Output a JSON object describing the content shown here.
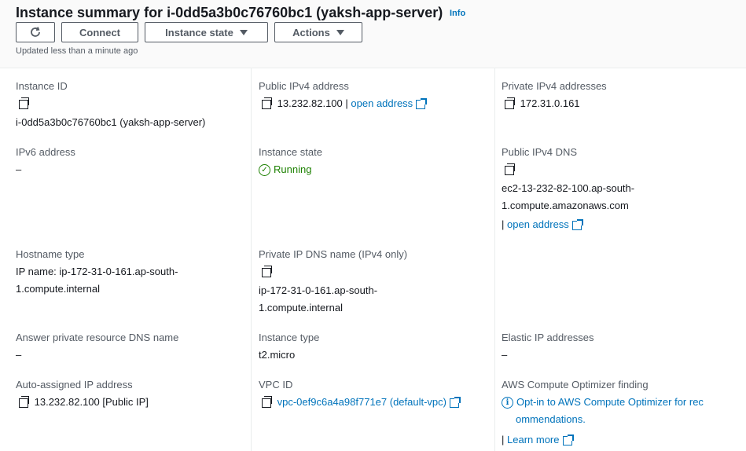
{
  "header": {
    "title": "Instance summary for i-0dd5a3b0c76760bc1 (yaksh-app-server)",
    "info_label": "Info",
    "connect_label": "Connect",
    "instance_state_label": "Instance state",
    "actions_label": "Actions",
    "updated_text": "Updated less than a minute ago",
    "refresh_icon": "refresh-icon"
  },
  "fields": {
    "instance_id": {
      "label": "Instance ID",
      "value": "i-0dd5a3b0c76760bc1 (yaksh-app-server)"
    },
    "public_ipv4": {
      "label": "Public IPv4 address",
      "value": "13.232.82.100",
      "separator": "|",
      "link": "open address"
    },
    "private_ipv4": {
      "label": "Private IPv4 addresses",
      "value": "172.31.0.161"
    },
    "ipv6": {
      "label": "IPv6 address",
      "value": "–"
    },
    "instance_state": {
      "label": "Instance state",
      "value": "Running"
    },
    "public_dns": {
      "label": "Public IPv4 DNS",
      "value_line1": "ec2-13-232-82-100.ap-south-",
      "value_line2": "1.compute.amazonaws.com",
      "separator": "|",
      "link": "open address"
    },
    "hostname_type": {
      "label": "Hostname type",
      "value_line1": "IP name: ip-172-31-0-161.ap-south-",
      "value_line2": "1.compute.internal"
    },
    "private_dns": {
      "label": "Private IP DNS name (IPv4 only)",
      "value_line1": "ip-172-31-0-161.ap-south-",
      "value_line2": "1.compute.internal"
    },
    "answer_dns": {
      "label": "Answer private resource DNS name",
      "value": "–"
    },
    "instance_type": {
      "label": "Instance type",
      "value": "t2.micro"
    },
    "elastic_ip": {
      "label": "Elastic IP addresses",
      "value": "–"
    },
    "auto_ip": {
      "label": "Auto-assigned IP address",
      "value": "13.232.82.100 [Public IP]"
    },
    "vpc_id": {
      "label": "VPC ID",
      "value": "vpc-0ef9c6a4a98f771e7 (default-vpc)"
    },
    "optimizer": {
      "label": "AWS Compute Optimizer finding",
      "line1": "Opt-in to AWS Compute Optimizer for rec",
      "line2": "ommendations.",
      "separator": "|",
      "learn_more": "Learn more"
    }
  },
  "colors": {
    "link": "#0073bb",
    "success": "#1d8102",
    "text": "#16191f",
    "label": "#545b64"
  }
}
